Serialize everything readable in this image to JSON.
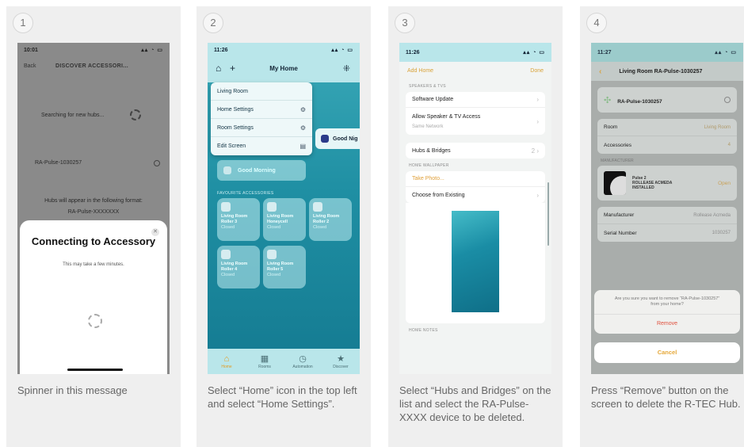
{
  "steps": [
    {
      "number": "1",
      "caption": "Spinner in this message",
      "status_time": "10:01",
      "header_back": "Back",
      "header_title": "DISCOVER ACCESSORI...",
      "searching_text": "Searching for new hubs...",
      "device_row": "RA-Pulse-1030257",
      "hint_text": "Hubs will appear in the following format:",
      "hint_format": "RA-Pulse-XXXXXXX",
      "sheet_title": "Connecting to Accessory",
      "sheet_subtitle": "This may take a few minutes."
    },
    {
      "number": "2",
      "caption": "Select “Home” icon in the top left and select “Home Settings”.",
      "status_time": "11:26",
      "nav_title": "My Home",
      "menu_items": [
        {
          "label": "Living Room",
          "glyph": ""
        },
        {
          "label": "Home Settings",
          "glyph": "⚙"
        },
        {
          "label": "Room Settings",
          "glyph": "⚙"
        },
        {
          "label": "Edit Screen",
          "glyph": "▤"
        }
      ],
      "good_night": "Good Nig",
      "good_morning": "Good Morning",
      "favourites_label": "FAVOURITE ACCESSORIES",
      "tiles": [
        {
          "line1": "Living Room",
          "line2": "Roller 3",
          "state": "Closed"
        },
        {
          "line1": "Living Room",
          "line2": "Honeycell",
          "state": "Closed"
        },
        {
          "line1": "Living Room",
          "line2": "Roller 2",
          "state": "Closed"
        },
        {
          "line1": "Living Room",
          "line2": "Roller 4",
          "state": "Closed"
        },
        {
          "line1": "Living Room",
          "line2": "Roller 5",
          "state": "Closed"
        }
      ],
      "tabs": [
        "Home",
        "Rooms",
        "Automation",
        "Discover"
      ]
    },
    {
      "number": "3",
      "caption": "Select “Hubs and Bridges” on the list and select the RA-Pulse- XXXX device to be deleted.",
      "status_time": "11:26",
      "nav_left": "Add Home",
      "nav_right": "Done",
      "section_speakers": "SPEAKERS & TVS",
      "software_update": "Software Update",
      "allow_access": "Allow Speaker & TV Access",
      "allow_access_value": "Same Network",
      "hubs_bridges": "Hubs & Bridges",
      "hubs_count": "2",
      "section_wallpaper": "HOME WALLPAPER",
      "take_photo": "Take Photo...",
      "choose_existing": "Choose from Existing",
      "section_notes": "HOME NOTES"
    },
    {
      "number": "4",
      "caption": "Press “Remove” button on the screen to delete the R-TEC Hub.",
      "status_time": "11:27",
      "nav_title": "Living Room RA-Pulse-1030257",
      "device_name": "RA-Pulse-1030257",
      "room_label": "Room",
      "room_value": "Living Room",
      "accessories_label": "Accessories",
      "accessories_value": "4",
      "section_manufacturer": "MANUFACTURER",
      "manu_line1": "Pulse 2",
      "manu_line2": "ROLLEASE ACMEDA",
      "manu_line3": "INSTALLED",
      "manu_open": "Open",
      "manufacturer_label": "Manufacturer",
      "manufacturer_value": "Rollease Acmeda",
      "serial_label": "Serial Number",
      "serial_value": "1030257",
      "alert_message": "Are you sure you want to remove “RA-Pulse-1030257” from your home?",
      "remove_label": "Remove",
      "cancel_label": "Cancel"
    }
  ]
}
